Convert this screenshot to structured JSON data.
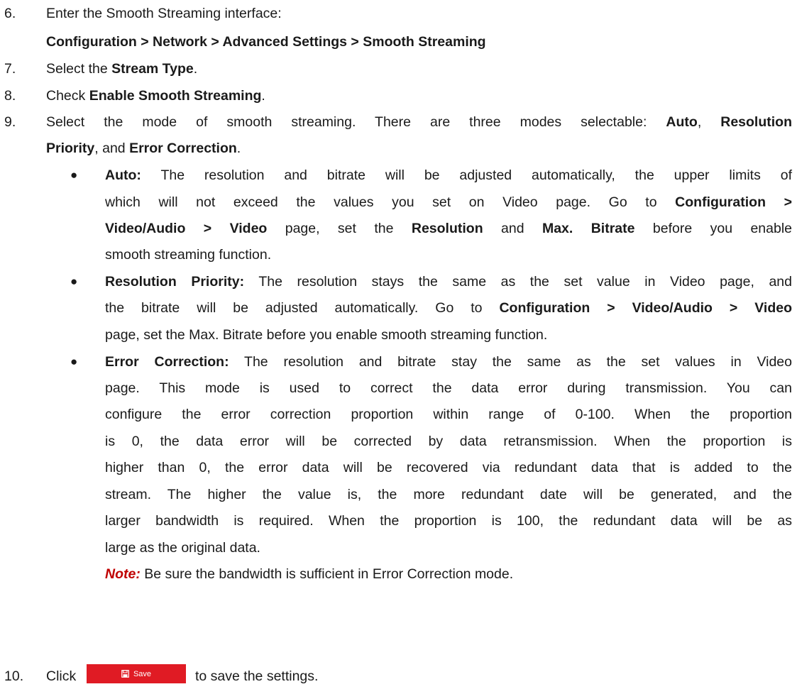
{
  "steps": {
    "s6": {
      "num": "6.",
      "text": "Enter the Smooth Streaming interface:",
      "path": "Configuration > Network > Advanced Settings > Smooth Streaming"
    },
    "s7": {
      "num": "7.",
      "pre": "Select the ",
      "bold": "Stream Type",
      "post": "."
    },
    "s8": {
      "num": "8.",
      "pre": "Check ",
      "bold": "Enable Smooth Streaming",
      "post": "."
    },
    "s9": {
      "num": "9.",
      "line1_pre": "Select the mode of smooth streaming. There are three modes selectable: ",
      "auto": "Auto",
      "comma": ",",
      "resolution": "Resolution",
      "priority": "Priority",
      "and": ", and ",
      "error_correction": "Error Correction",
      "end": "."
    },
    "s10": {
      "num": "10.",
      "click": "Click",
      "post": "to save the settings."
    }
  },
  "bullets": {
    "auto": {
      "label": "Auto:",
      "l1": " The resolution and bitrate will be adjusted automatically, the upper limits of",
      "l2_pre": "which will not exceed the values you set on Video page. Go to ",
      "l2_bold": "Configuration >",
      "l3_bold1": "Video/Audio > Video",
      "l3_mid": " page, set the ",
      "l3_bold2": "Resolution",
      "l3_and": " and ",
      "l3_bold3": "Max. Bitrate",
      "l3_post": " before you enable",
      "l4": "smooth streaming function."
    },
    "resolution_priority": {
      "label": "Resolution Priority:",
      "l1": " The resolution stays the same as the set value in Video page, and",
      "l2_pre": "the bitrate will be adjusted automatically. Go to ",
      "l2_bold": "Configuration > Video/Audio > Video",
      "l3": "page, set the Max. Bitrate before you enable smooth streaming function."
    },
    "error_correction": {
      "label": "Error Correction:",
      "l1": " The resolution and bitrate stay the same as the set values in Video",
      "l2": "page. This mode is used to correct the data error during transmission. You can",
      "l3": "configure the error correction proportion within range of 0-100. When the proportion",
      "l4": "is 0, the data error will be corrected by data retransmission. When the proportion is",
      "l5": "higher than 0, the error data will be recovered via redundant data that is added to the",
      "l6": "stream. The higher the value is, the more redundant date will be generated, and the",
      "l7": "larger bandwidth is required. When the proportion is 100, the redundant data will be as",
      "l8": "large as the original data.",
      "note_label": "Note:",
      "note_text": " Be sure the bandwidth is sufficient in Error Correction mode."
    }
  },
  "save_button": {
    "label": "Save",
    "icon": "floppy-disk-icon",
    "color": "#e01b24"
  }
}
